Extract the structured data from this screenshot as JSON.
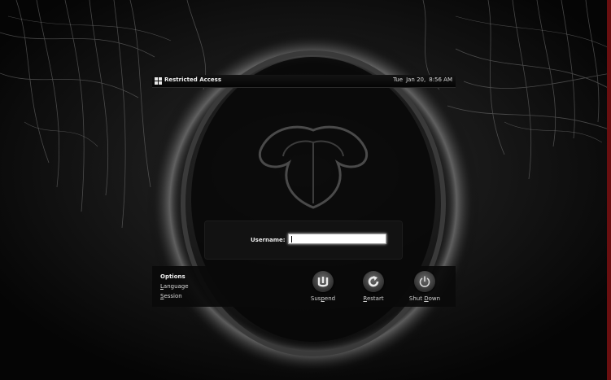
{
  "topbar": {
    "title": "Restricted Access",
    "day": "Tue",
    "date": "Jan 20,",
    "time": "8:56 AM"
  },
  "login": {
    "username_label": "Username:",
    "username_value": ""
  },
  "options": {
    "title": "Options",
    "language": {
      "accel": "L",
      "rest": "anguage"
    },
    "session": {
      "accel": "S",
      "rest": "ession"
    }
  },
  "actions": {
    "suspend": {
      "pre": "Sus",
      "accel": "p",
      "post": "end",
      "icon": "suspend-icon"
    },
    "restart": {
      "pre": "",
      "accel": "R",
      "post": "estart",
      "icon": "restart-icon"
    },
    "shutdown": {
      "pre": "Shut ",
      "accel": "D",
      "post": "own",
      "icon": "power-icon"
    }
  },
  "colors": {
    "panel": "#0a0a0a",
    "accent_edge": "#6a0f10"
  }
}
